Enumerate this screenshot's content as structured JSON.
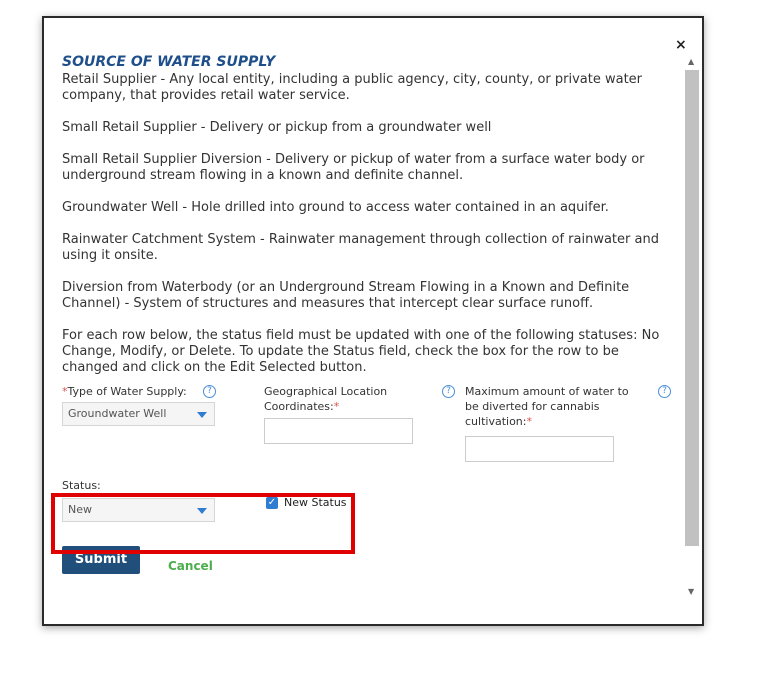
{
  "dialog": {
    "close_glyph": "×",
    "section_title": "SOURCE OF WATER SUPPLY",
    "definitions": [
      "Retail Supplier - Any local entity, including a public agency, city, county, or private water company, that provides retail water service.",
      "Small Retail Supplier - Delivery or pickup from a groundwater well",
      "Small Retail Supplier Diversion - Delivery or pickup of water from a surface water body or underground stream flowing in a known and definite channel.",
      "Groundwater Well - Hole drilled into ground to access water contained in an aquifer.",
      "Rainwater Catchment System - Rainwater management through collection of rainwater and using it onsite.",
      "Diversion from Waterbody (or an Underground Stream Flowing in a Known and Definite Channel) - System of structures and measures that intercept clear surface runoff.",
      "For each row below, the status field must be updated with one of the following statuses: No Change, Modify, or Delete. To update the Status field, check the box for the row to be changed and click on the Edit Selected button."
    ],
    "fields": {
      "type_label": "Type of Water Supply:",
      "type_value": "Groundwater Well",
      "geo_label_line1": "Geographical Location",
      "geo_label_line2": "Coordinates:",
      "max_label_line1": "Maximum amount of water to",
      "max_label_line2": "be diverted for cannabis",
      "max_label_line3": "cultivation:",
      "required_mark": "*",
      "help_glyph": "?"
    },
    "status": {
      "label": "Status:",
      "value": "New",
      "checkbox_label": "New Status",
      "checkbox_checked": true
    },
    "actions": {
      "submit_label": "Submit",
      "cancel_label": "Cancel"
    }
  },
  "colors": {
    "title": "#1f4f8a",
    "submit_bg": "#1f4f7a",
    "cancel_text": "#4cae4c",
    "highlight_border": "#e00000",
    "required": "#d9534f"
  }
}
